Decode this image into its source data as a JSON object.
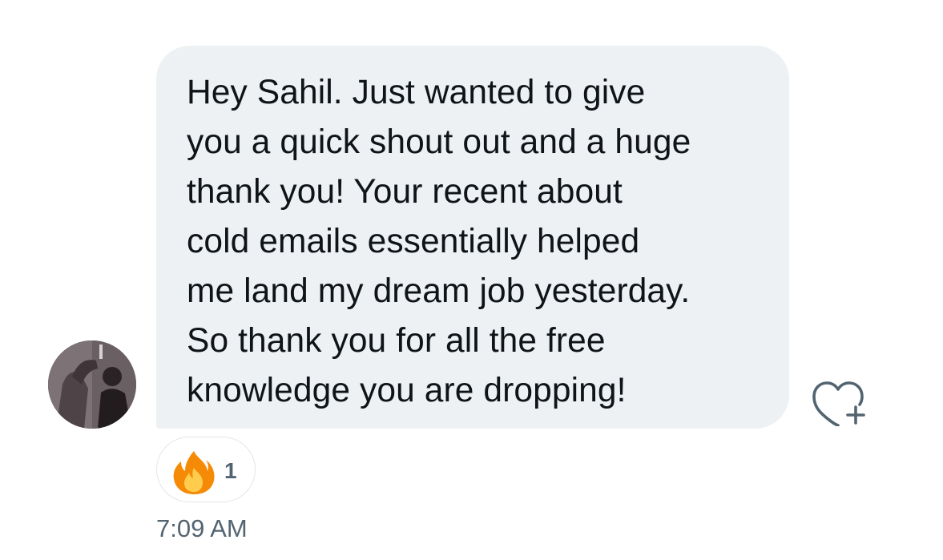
{
  "message": {
    "lines": [
      "Hey Sahil. Just wanted to give",
      "you a quick shout out and a huge",
      "thank you! Your recent about",
      "cold emails essentially helped",
      "me land my dream job yesterday.",
      "So thank you for all the free",
      "knowledge you are dropping!"
    ],
    "timestamp": "7:09 AM"
  },
  "reaction": {
    "emoji": "fire-emoji",
    "count": "1"
  },
  "icons": {
    "avatar": "sender-avatar",
    "add_reaction": "heart-plus-icon"
  },
  "colors": {
    "bubble_background": "#eef1f3",
    "text": "#0f1419",
    "secondary_text": "#536471",
    "pill_border": "#e1e6ea"
  }
}
